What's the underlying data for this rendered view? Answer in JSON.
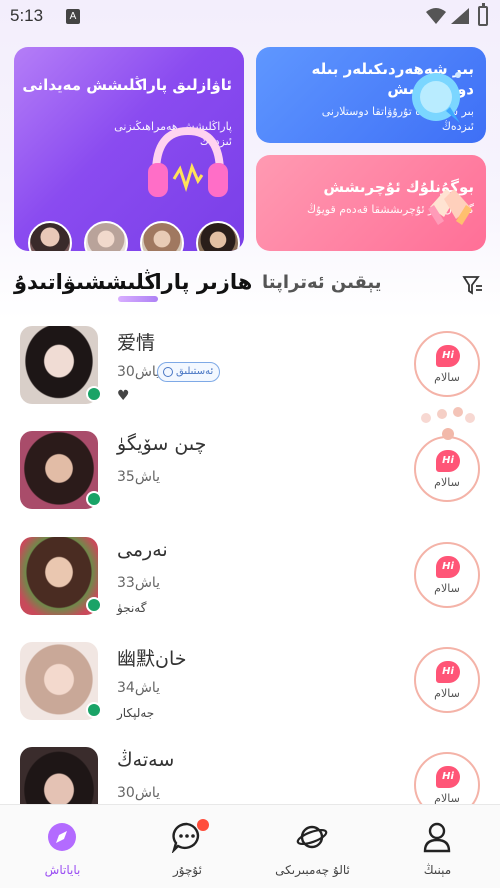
{
  "status_bar": {
    "time": "5:13",
    "sim_label": "A"
  },
  "cards": {
    "voice": {
      "title": "ئاۋازلىق پاراڭلىشش مەيدانى",
      "subtitle": "پاراڭلىشش ھەمراھىڭىزنى ئىزدەڭ"
    },
    "city": {
      "title": "بىر شەھەردىكىلەر بىلە دوستلىشش",
      "subtitle": "بىر شەھەردە تۇرۇۋاتقا دوستلارنى ئىزدەڭ"
    },
    "match": {
      "title": "بوگۇنلۇك ئۇچرىشش",
      "subtitle": "گۈزەل بىر ئۇچرىششقا قەدەم قويۇڭ"
    }
  },
  "tabs": {
    "active": "ھازىر پاراڭلىششىۋاتىدۇ",
    "inactive": "يېقىن ئەتراپتا"
  },
  "users": [
    {
      "name": "爱情",
      "age": "30ياش",
      "tag": "ئەستىلىق",
      "heart": "♥",
      "interest": "",
      "online": true,
      "hi_label": "سالام"
    },
    {
      "name": "چىن  سۆيگۈ",
      "age": "35ياش",
      "tag": "",
      "heart": "",
      "interest": "",
      "online": true,
      "hi_label": "سالام"
    },
    {
      "name": "نەرمى",
      "age": "33ياش",
      "tag": "",
      "heart": "",
      "interest": "گەنجۈ",
      "online": true,
      "hi_label": "سالام"
    },
    {
      "name": "幽默خان",
      "age": "34ياش",
      "tag": "",
      "heart": "",
      "interest": "جەلپكار",
      "online": true,
      "hi_label": "سالام"
    },
    {
      "name": "سەتەڭ",
      "age": "30ياش",
      "tag": "",
      "heart": "",
      "interest": "",
      "online": false,
      "hi_label": "سالام"
    }
  ],
  "hi_text": "Hi",
  "bottom_nav": [
    {
      "label": "باياتاش",
      "icon": "compass-icon",
      "active": true
    },
    {
      "label": "ئۇچۇر",
      "icon": "chat-bubble-icon",
      "active": false,
      "badge": true
    },
    {
      "label": "ئالۇ چەمبىرىكى",
      "icon": "planet-icon",
      "active": false
    },
    {
      "label": "مېنىڭ",
      "icon": "user-icon",
      "active": false
    }
  ],
  "colors": {
    "accent_purple": "#9b4ff3",
    "online_green": "#1aa367",
    "hi_pink": "#ff5577",
    "badge_red": "#ff4d3b"
  }
}
